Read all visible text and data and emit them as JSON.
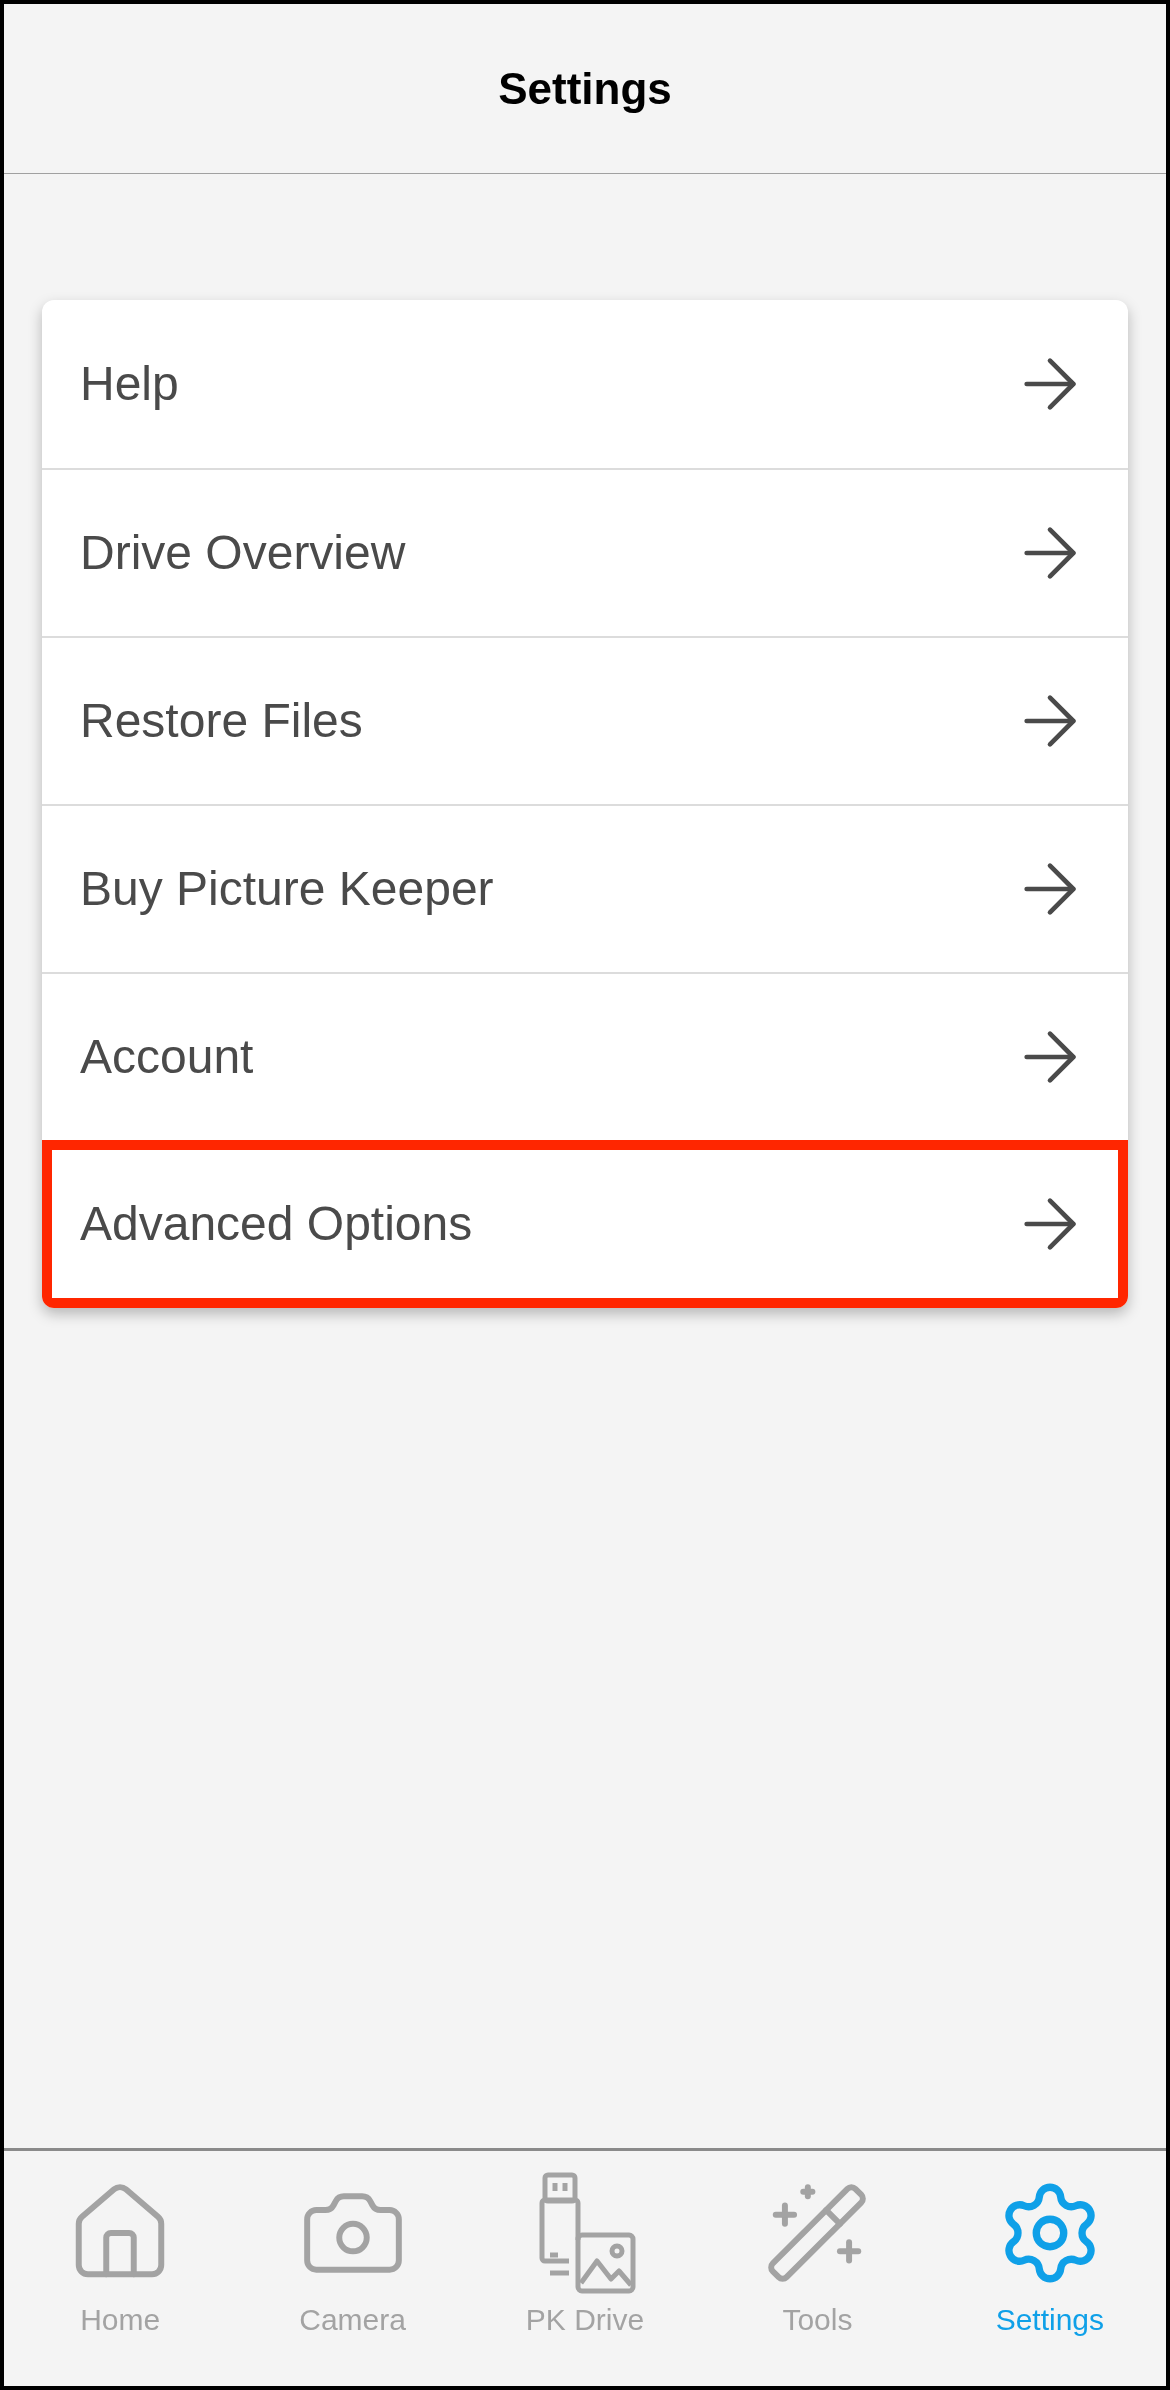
{
  "header": {
    "title": "Settings"
  },
  "menu": [
    {
      "label": "Help",
      "highlighted": false
    },
    {
      "label": "Drive Overview",
      "highlighted": false
    },
    {
      "label": "Restore Files",
      "highlighted": false
    },
    {
      "label": "Buy Picture Keeper",
      "highlighted": false
    },
    {
      "label": "Account",
      "highlighted": false
    },
    {
      "label": "Advanced Options",
      "highlighted": true
    }
  ],
  "tab_bar": [
    {
      "kind": "home",
      "label": "Home",
      "selected": false
    },
    {
      "kind": "camera",
      "label": "Camera",
      "selected": false
    },
    {
      "kind": "drive",
      "label": "PK Drive",
      "selected": false
    },
    {
      "kind": "tools",
      "label": "Tools",
      "selected": false
    },
    {
      "kind": "settings",
      "label": "Settings",
      "selected": true
    }
  ]
}
